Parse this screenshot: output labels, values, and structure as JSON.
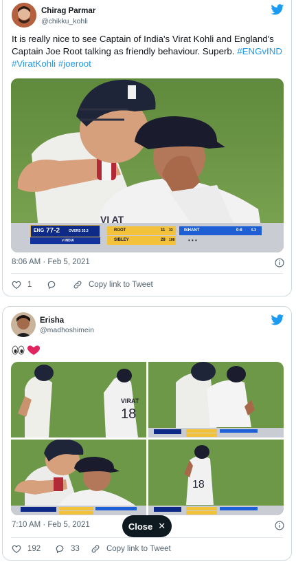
{
  "tweet1": {
    "display_name": "Chirag Parmar",
    "handle": "@chikku_kohli",
    "text_plain": "It is really nice to see Captain of India's Virat Kohli and England's Captain Joe Root talking as friendly behaviour. Superb. ",
    "hashtags": [
      "#ENGvIND",
      "#ViratKohli",
      "#joeroot"
    ],
    "timestamp": "8:06 AM · Feb 5, 2021",
    "like_count": "1",
    "copy_link_label": "Copy link to Tweet",
    "scoreboard": {
      "team": "ENG",
      "score": "77-2",
      "overs_label": "OVERS 33.3",
      "vs": "v INDIA",
      "bat1": "ROOT",
      "bat1_score": "11",
      "bat1_balls": "33",
      "bat2": "SIBLEY",
      "bat2_score": "28",
      "bat2_balls": "108",
      "bowler": "ISHANT",
      "bowler_fig": "0-8",
      "bowler_overs": "5.3"
    }
  },
  "tweet2": {
    "display_name": "Erisha",
    "handle": "@madhoshimein",
    "timestamp": "7:10 AM · Feb 5, 2021",
    "like_count": "192",
    "reply_count": "33",
    "copy_link_label": "Copy link to Tweet",
    "jersey_name": "VIRAT",
    "jersey_number": "18"
  },
  "close_button": {
    "label": "Close"
  },
  "colors": {
    "accent": "#1d9bf0",
    "heart": "#e0245e",
    "field": "#6f9a48"
  },
  "icons": [
    "twitter-bird-icon",
    "info-icon",
    "heart-icon",
    "reply-icon",
    "link-icon",
    "close-icon",
    "eyes-emoji",
    "red-heart-emoji"
  ]
}
